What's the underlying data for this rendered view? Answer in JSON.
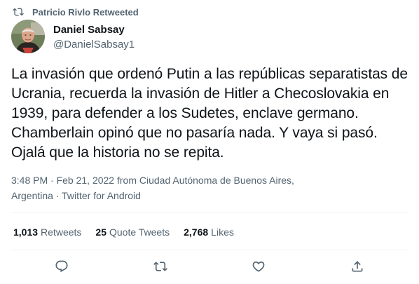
{
  "retweet_header": {
    "text": "Patricio Rivlo Retweeted",
    "icon": "retweet-icon"
  },
  "author": {
    "name": "Daniel Sabsay",
    "handle": "@DanielSabsay1"
  },
  "tweet": {
    "text": "La invasión que ordenó Putin a las repúblicas separatistas de Ucrania, recuerda la invasión de Hitler a Checoslovakia en 1939, para defender a los Sudetes, enclave germano. Chamberlain opinó que no pasaría nada. Y vaya si pasó. Ojalá que la historia no se repita."
  },
  "meta": {
    "line1": "3:48 PM · Feb 21, 2022 from Ciudad Autónoma de Buenos Aires,",
    "line2": "Argentina · Twitter for Android"
  },
  "stats": {
    "retweets_count": "1,013",
    "retweets_label": "Retweets",
    "quotes_count": "25",
    "quotes_label": "Quote Tweets",
    "likes_count": "2,768",
    "likes_label": "Likes"
  },
  "actions": [
    {
      "name": "reply",
      "icon": "reply-icon"
    },
    {
      "name": "retweet",
      "icon": "retweet-icon"
    },
    {
      "name": "like",
      "icon": "heart-icon"
    },
    {
      "name": "share",
      "icon": "share-icon"
    }
  ],
  "colors": {
    "text": "#0f1419",
    "secondary": "#536471",
    "divider": "#eff3f4"
  }
}
